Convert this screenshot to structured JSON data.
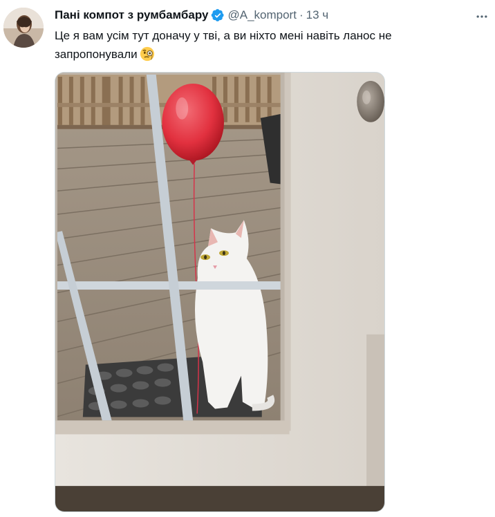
{
  "tweet": {
    "display_name": "Пані компот з румбамбару",
    "handle": "@A_komport",
    "separator": "·",
    "time": "13 ч",
    "text": "Це я вам усім тут доначу у тві, а ви ніхто мені навіть ланос не запропонували",
    "emoji_icon": "face-with-monocle-icon"
  },
  "colors": {
    "text": "#0f1419",
    "secondary": "#536471",
    "verified": "#1d9bf0",
    "balloon": "#e2313f"
  },
  "icons": {
    "verified": "verified-badge-icon",
    "more": "more-options-icon"
  }
}
